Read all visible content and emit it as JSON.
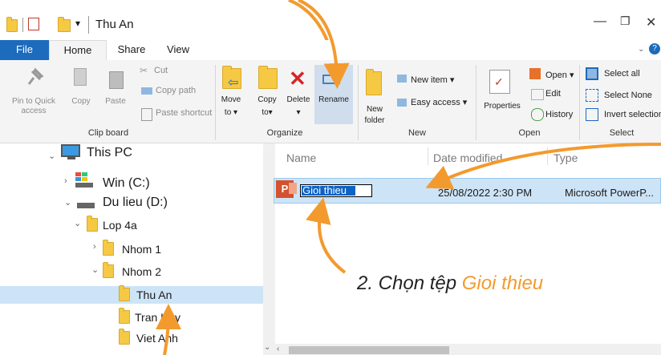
{
  "window": {
    "title": "Thu An",
    "qat_dropdown": "▾"
  },
  "tabs": [
    {
      "label": "File"
    },
    {
      "label": "Home"
    },
    {
      "label": "Share"
    },
    {
      "label": "View"
    }
  ],
  "ribbon": {
    "clipboard": {
      "pin_label_1": "Pin to Quick",
      "pin_label_2": "access",
      "copy": "Copy",
      "paste": "Paste",
      "cut": "Cut",
      "copy_path": "Copy path",
      "paste_shortcut": "Paste shortcut",
      "group": "Clip board"
    },
    "organize": {
      "move_1": "Move",
      "move_2": "to ▾",
      "copy_1": "Copy",
      "copy_2": "to▾",
      "delete_1": "Delete",
      "delete_2": "▾",
      "rename": "Rename",
      "group": "Organize"
    },
    "new": {
      "folder_1": "New",
      "folder_2": "folder",
      "new_item": "New item ▾",
      "easy_access": "Easy access ▾",
      "group": "New"
    },
    "open": {
      "properties": "Properties",
      "open": "Open ▾",
      "edit": "Edit",
      "history": "History",
      "group": "Open"
    },
    "select": {
      "select_all": "Select all",
      "select_none": "Select None",
      "invert": "Invert selection",
      "group": "Select"
    }
  },
  "nav": {
    "this_pc": "This PC",
    "win_c": "Win (C:)",
    "du_lieu": "Du lieu (D:)",
    "lop": "Lop 4a",
    "nhom1": "Nhom 1",
    "nhom2": "Nhom 2",
    "thu_an": "Thu An",
    "tran_huy": "Tran Huy",
    "viet_anh": "Viet Anh"
  },
  "list": {
    "columns": [
      "Name",
      "Date modified",
      "Type"
    ],
    "row": {
      "name": "Gioi thieu",
      "date": "25/08/2022 2:30 PM",
      "type": "Microsoft PowerP..."
    }
  },
  "caption": {
    "prefix": "2. Chọn tệp ",
    "highlight": "Gioi thieu"
  },
  "colors": {
    "accent": "#1c6bbd",
    "arrow": "#f39a2e",
    "selection": "#cde4f7"
  },
  "icons": [
    "folder-icon",
    "pc-icon",
    "drive-icon",
    "powerpoint-icon",
    "pin-icon",
    "copy-icon",
    "paste-icon",
    "cut-icon",
    "delete-icon",
    "rename-icon",
    "properties-icon",
    "help-icon"
  ]
}
